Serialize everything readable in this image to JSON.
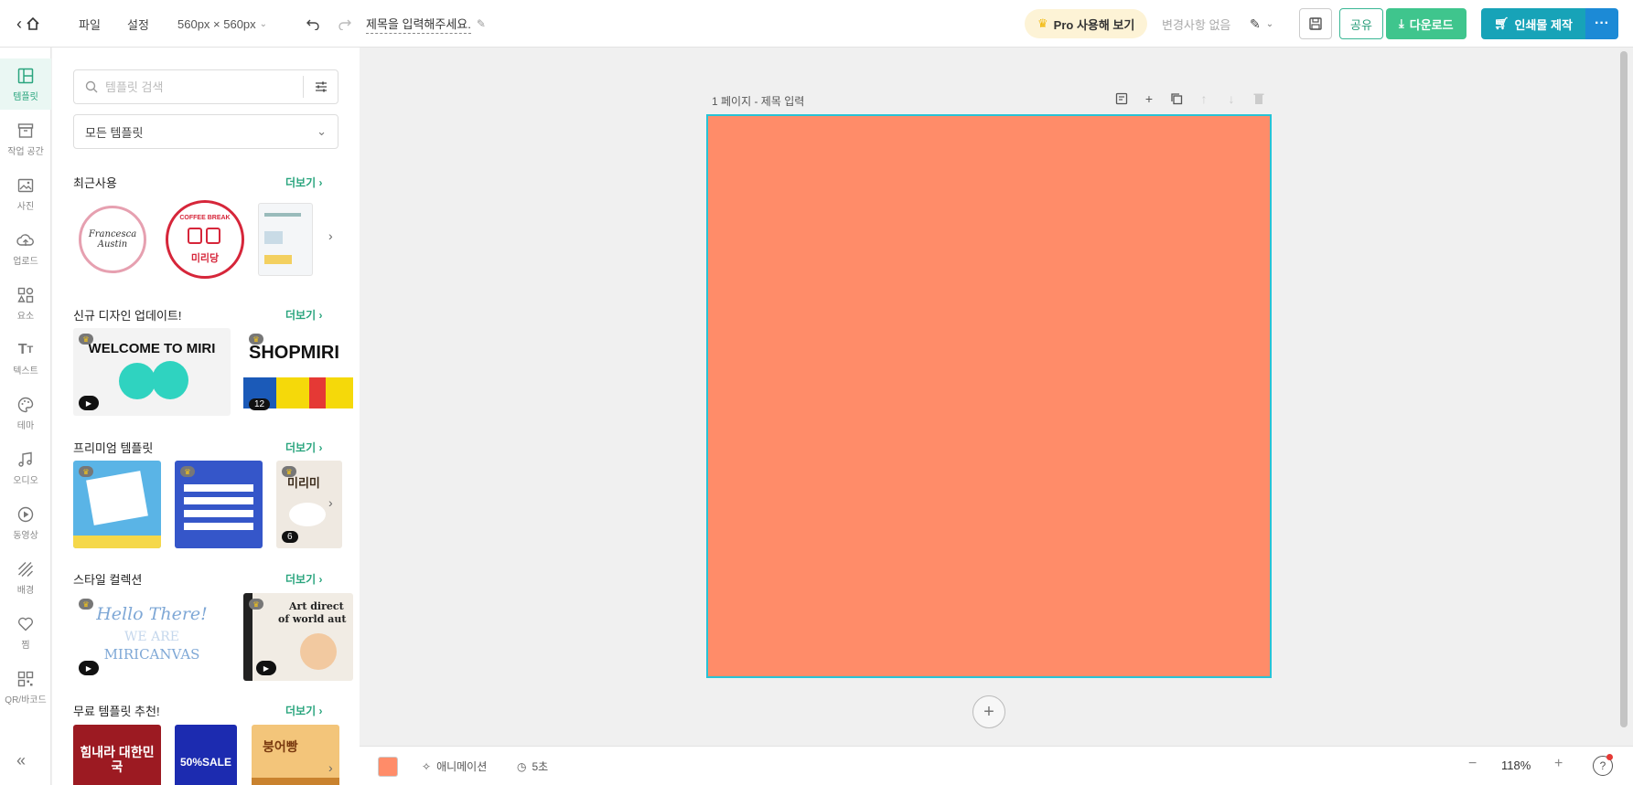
{
  "header": {
    "file_menu": "파일",
    "settings_menu": "설정",
    "size": "560px × 560px",
    "title": "제목을 입력해주세요.",
    "pro_button": "Pro 사용해 보기",
    "changes_status": "변경사항 없음",
    "share_button": "공유",
    "download_button": "다운로드",
    "print_button": "인쇄물 제작",
    "more_button": "···"
  },
  "rail": {
    "items": [
      {
        "label": "템플릿",
        "icon": "template-icon"
      },
      {
        "label": "작업 공간",
        "icon": "archive-icon"
      },
      {
        "label": "사진",
        "icon": "photo-icon"
      },
      {
        "label": "업로드",
        "icon": "upload-cloud-icon"
      },
      {
        "label": "요소",
        "icon": "elements-icon"
      },
      {
        "label": "텍스트",
        "icon": "text-icon"
      },
      {
        "label": "테마",
        "icon": "palette-icon"
      },
      {
        "label": "오디오",
        "icon": "music-icon"
      },
      {
        "label": "동영상",
        "icon": "video-icon"
      },
      {
        "label": "배경",
        "icon": "background-icon"
      },
      {
        "label": "찜",
        "icon": "heart-icon"
      },
      {
        "label": "QR/바코드",
        "icon": "qr-icon"
      }
    ]
  },
  "panel": {
    "search_placeholder": "템플릿 검색",
    "filter_value": "모든 템플릿",
    "more_label": "더보기",
    "sections": {
      "recent": "최근사용",
      "new_designs": "신규 디자인 업데이트!",
      "premium": "프리미엄 템플릿",
      "style": "스타일 컬렉션",
      "free": "무료 템플릿 추천!"
    },
    "thumbs": {
      "recent_1_line1": "Francesca",
      "recent_1_line2": "Austin",
      "recent_2_top": "COFFEE BREAK",
      "recent_2_bottom": "미리당",
      "new_1": "WELCOME TO MIRI",
      "new_2": "SHOPMIRI",
      "new_2_count": "12",
      "premium_3": "미리미",
      "premium_3_count": "6",
      "style_1_line1": "Hello There!",
      "style_1_line2": "WE ARE",
      "style_1_line3": "MIRICANVAS",
      "style_2_line1": "Art direct",
      "style_2_line2": "of world aut",
      "free_1": "힘내라 대한민국",
      "free_2": "50%SALE",
      "free_3": "붕어빵"
    }
  },
  "canvas": {
    "page_label": "1 페이지 - 제목 입력",
    "background_color": "#ff8c69",
    "border_color": "#27c3d6"
  },
  "footer": {
    "animation": "애니메이션",
    "timer": "5초",
    "zoom": "118%"
  },
  "colors": {
    "accent_green": "#3fc58d",
    "accent_teal": "#17a3b8",
    "accent_blue": "#1c8ad6"
  }
}
